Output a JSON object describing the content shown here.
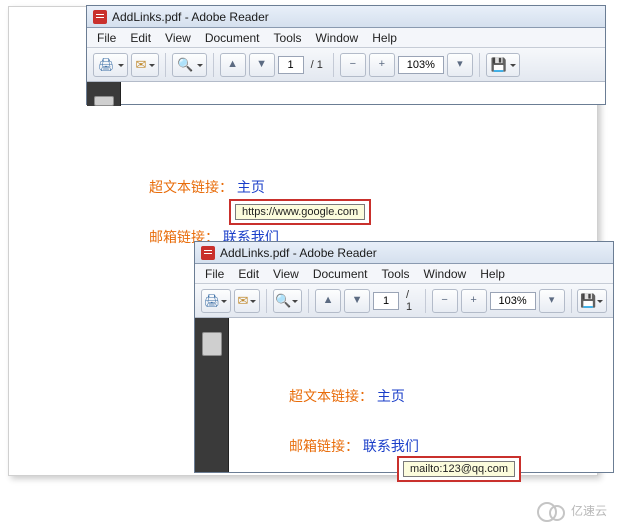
{
  "window": {
    "title": "AddLinks.pdf - Adobe Reader",
    "menu": [
      "File",
      "Edit",
      "View",
      "Document",
      "Tools",
      "Window",
      "Help"
    ],
    "toolbar": {
      "page_current": "1",
      "page_total": "/ 1",
      "zoom": "103%"
    }
  },
  "content1": {
    "hyper_label": "超文本链接：",
    "hyper_link": "主页",
    "mail_label": "邮箱链接：",
    "mail_link": "联系我们",
    "tooltip": "https://www.google.com"
  },
  "content2": {
    "hyper_label": "超文本链接：",
    "hyper_link": "主页",
    "mail_label": "邮箱链接：",
    "mail_link": "联系我们",
    "tooltip": "mailto:123@qq.com"
  },
  "watermark": "亿速云"
}
